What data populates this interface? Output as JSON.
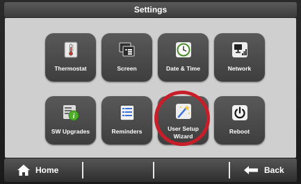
{
  "header": {
    "title": "Settings"
  },
  "tiles": [
    {
      "label": "Thermostat",
      "icon": "thermostat-icon"
    },
    {
      "label": "Screen",
      "icon": "screen-icon"
    },
    {
      "label": "Date & Time",
      "icon": "clock-icon"
    },
    {
      "label": "Network",
      "icon": "network-icon"
    },
    {
      "label": "SW Upgrades",
      "icon": "info-icon"
    },
    {
      "label": "Reminders",
      "icon": "list-icon"
    },
    {
      "label": "User Setup\nWizard",
      "icon": "wizard-icon"
    },
    {
      "label": "Reboot",
      "icon": "power-icon"
    }
  ],
  "highlight_color": "#c81e2a",
  "footer": {
    "home_label": "Home",
    "back_label": "Back"
  }
}
